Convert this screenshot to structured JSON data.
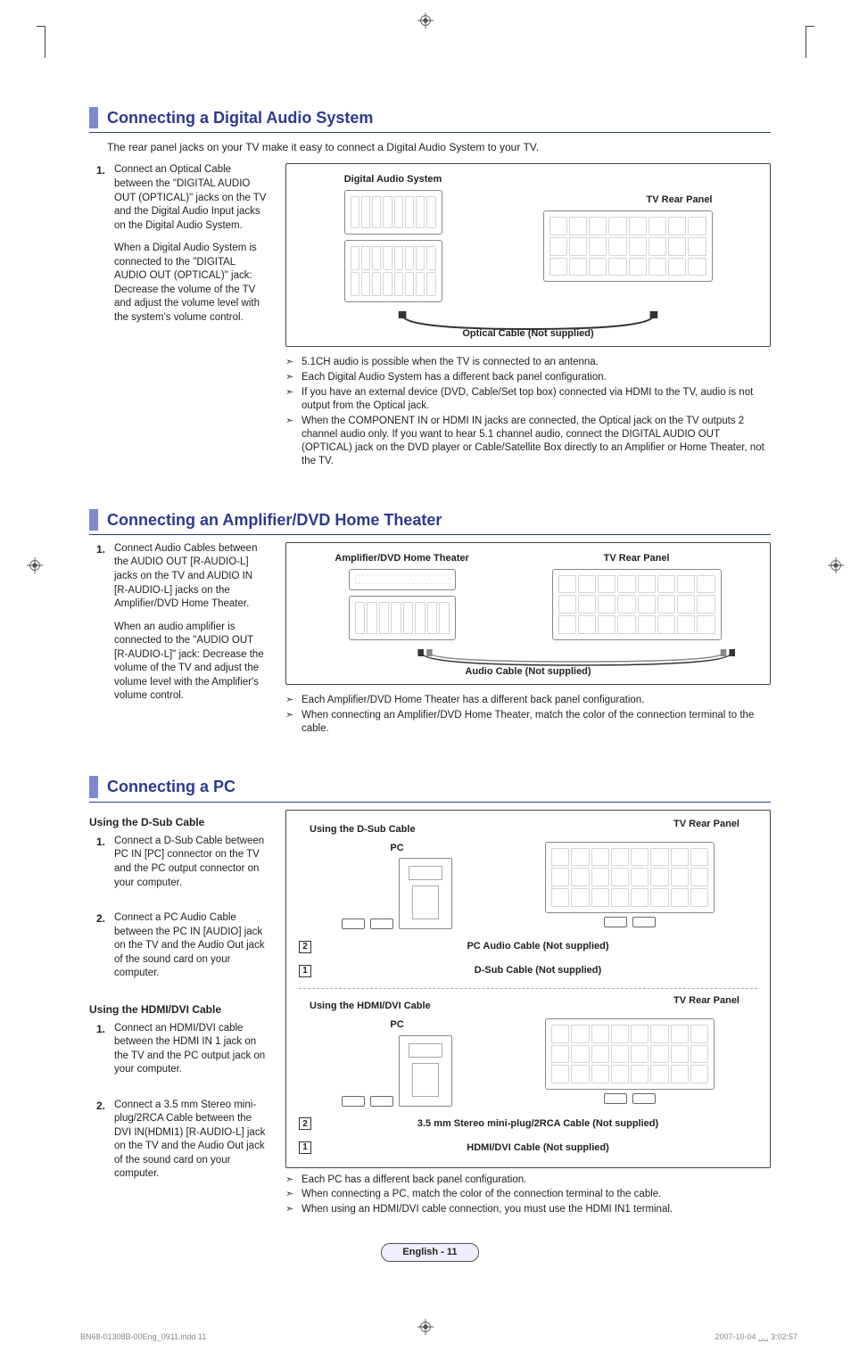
{
  "sections": {
    "digital": {
      "title": "Connecting a Digital Audio System",
      "intro": "The rear panel jacks on your TV make it easy to connect a Digital Audio System to your TV.",
      "steps": [
        {
          "num": "1.",
          "p1": "Connect an Optical Cable between the \"DIGITAL AUDIO OUT (OPTICAL)\" jacks on the TV and the Digital Audio Input jacks on the Digital Audio System.",
          "p2": "When a Digital Audio System is connected to the \"DIGITAL AUDIO OUT (OPTICAL)\" jack: Decrease the volume of the TV and adjust the volume level with the system's volume control."
        }
      ],
      "figure": {
        "left_label": "Digital Audio System",
        "right_label": "TV Rear Panel",
        "cable_label": "Optical Cable (Not supplied)"
      },
      "notes": [
        "5.1CH audio is possible when the TV is connected to an antenna.",
        "Each Digital Audio System has a different back panel configuration.",
        "If you have an external device (DVD, Cable/Set top box) connected via HDMI to the TV, audio is not output from the Optical jack.",
        "When the COMPONENT IN or HDMI IN jacks are connected, the Optical jack on the TV outputs 2 channel audio only. If you want to hear 5.1 channel audio, connect the DIGITAL AUDIO OUT (OPTICAL) jack on the DVD player or Cable/Satellite Box directly to an Amplifier or Home Theater, not the TV."
      ]
    },
    "amp": {
      "title": "Connecting an Amplifier/DVD Home Theater",
      "steps": [
        {
          "num": "1.",
          "p1": "Connect Audio Cables between the AUDIO OUT [R-AUDIO-L] jacks on the TV and AUDIO IN [R-AUDIO-L] jacks  on the Amplifier/DVD Home Theater.",
          "p2": "When an audio amplifier is connected to the \"AUDIO OUT [R-AUDIO-L]\" jack: Decrease the volume of the TV and adjust the volume level with the Amplifier's volume control."
        }
      ],
      "figure": {
        "left_label": "Amplifier/DVD Home Theater",
        "right_label": "TV Rear Panel",
        "cable_label": "Audio Cable (Not supplied)"
      },
      "notes": [
        "Each Amplifier/DVD Home Theater has a different back panel configuration.",
        "When connecting an Amplifier/DVD Home Theater, match the color of the connection terminal to the cable."
      ]
    },
    "pc": {
      "title": "Connecting a PC",
      "dsub_heading": "Using the D-Sub Cable",
      "dsub_steps": [
        {
          "num": "1.",
          "text": "Connect a D-Sub Cable between PC IN [PC] connector on the TV and the PC output connector on your computer."
        },
        {
          "num": "2.",
          "text": "Connect a PC Audio Cable between the PC IN [AUDIO] jack on the TV and the Audio Out jack of the sound card on your computer."
        }
      ],
      "hdmi_heading": "Using the HDMI/DVI Cable",
      "hdmi_steps": [
        {
          "num": "1.",
          "text": "Connect an HDMI/DVI cable between the HDMI IN 1 jack on the TV and the PC output jack on your computer."
        },
        {
          "num": "2.",
          "text": "Connect a 3.5 mm Stereo mini-plug/2RCA Cable between the DVI IN(HDMI1) [R-AUDIO-L] jack on the TV and the Audio Out jack of the sound card on your computer."
        }
      ],
      "figure": {
        "dsub_title": "Using the D-Sub Cable",
        "hdmi_title": "Using the HDMI/DVI Cable",
        "rear_label": "TV Rear Panel",
        "pc_label": "PC",
        "cable_dsub_audio": "PC Audio Cable (Not supplied)",
        "cable_dsub_video": "D-Sub Cable (Not supplied)",
        "cable_hdmi_audio": "3.5 mm Stereo mini-plug/2RCA Cable (Not supplied)",
        "cable_hdmi_video": "HDMI/DVI Cable (Not supplied)",
        "num1": "1",
        "num2": "2"
      },
      "notes": [
        "Each PC has a different back panel configuration.",
        "When connecting a PC, match the color of the connection terminal to the cable.",
        "When using an HDMI/DVI cable connection, you must use the HDMI IN1 terminal."
      ]
    }
  },
  "page_badge": "English - 11",
  "footer": {
    "left": "BN68-01308B-00Eng_0911.indd   11",
    "right": "2007-10-04   ␣␣ 3:02:57"
  }
}
